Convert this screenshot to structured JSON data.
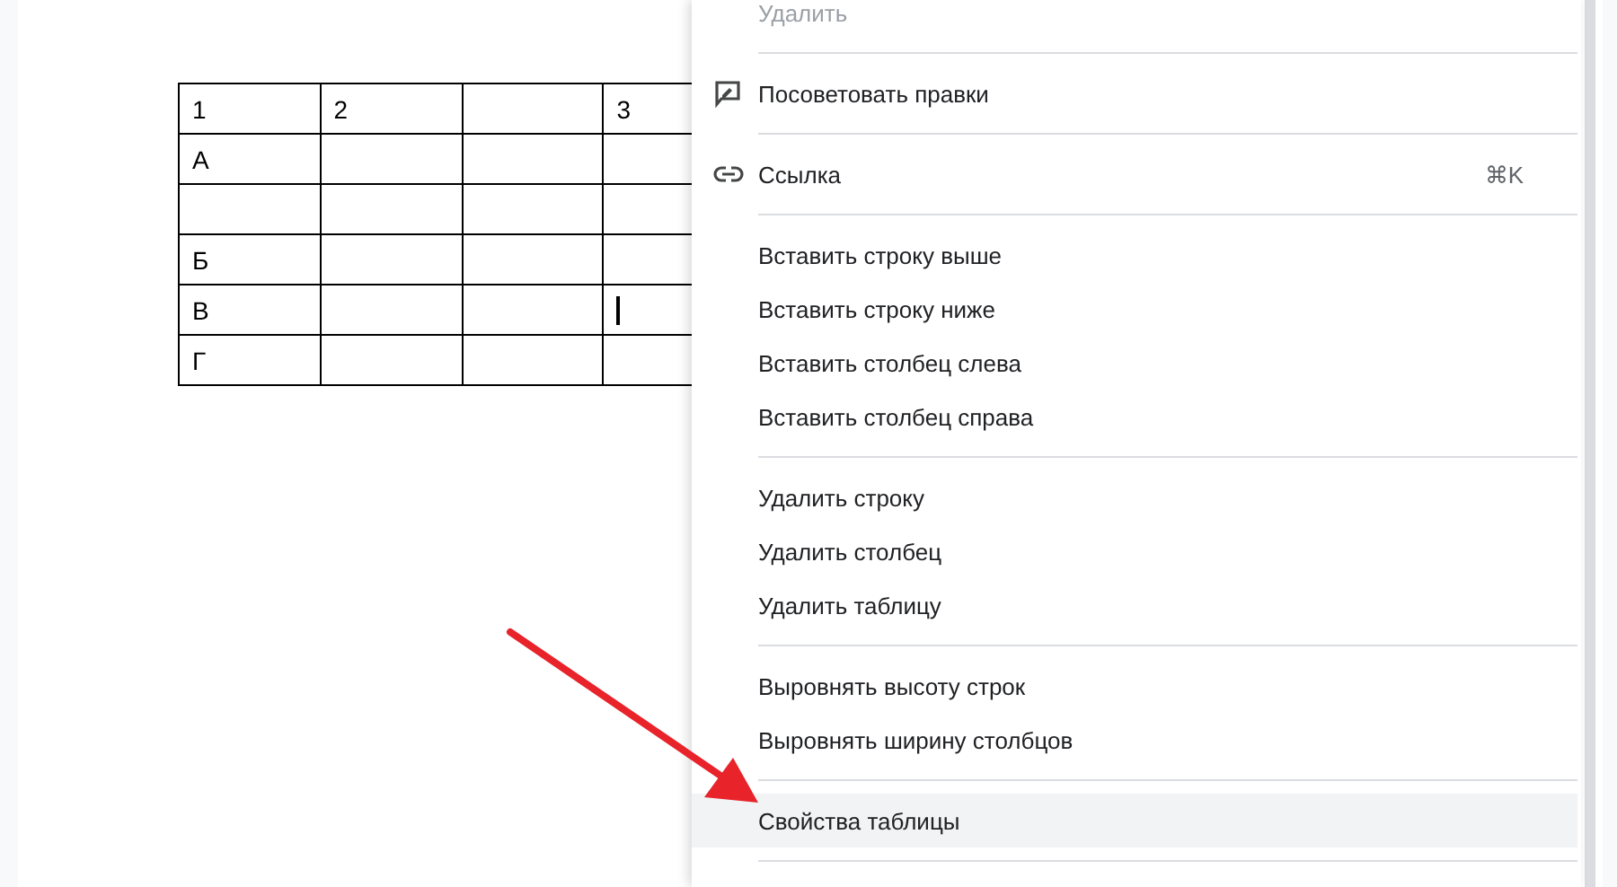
{
  "table": {
    "rows": [
      {
        "cells": [
          {
            "text": "1"
          },
          {
            "text": "2"
          },
          {},
          {
            "text": "3"
          }
        ]
      },
      {
        "cells": [
          {
            "text": "А"
          },
          {},
          {},
          {}
        ]
      },
      {
        "cells": [
          {},
          {},
          {},
          {}
        ]
      },
      {
        "cells": [
          {
            "text": "Б"
          },
          {},
          {},
          {}
        ]
      },
      {
        "cells": [
          {
            "text": "В"
          },
          {},
          {},
          {
            "cursor": true
          }
        ]
      },
      {
        "cells": [
          {
            "text": "Г"
          },
          {},
          {},
          {}
        ]
      }
    ]
  },
  "context_menu": {
    "items": [
      {
        "kind": "item",
        "label": "Удалить",
        "disabled": true,
        "selected": false
      },
      {
        "kind": "divider"
      },
      {
        "kind": "suggest",
        "label": "Посоветовать правки",
        "disabled": false,
        "selected": false
      },
      {
        "kind": "divider"
      },
      {
        "kind": "link",
        "label": "Ссылка",
        "shortcut": "⌘K",
        "disabled": false,
        "selected": false
      },
      {
        "kind": "divider"
      },
      {
        "kind": "item",
        "label": "Вставить строку выше",
        "disabled": false,
        "selected": false
      },
      {
        "kind": "item",
        "label": "Вставить строку ниже",
        "disabled": false,
        "selected": false
      },
      {
        "kind": "item",
        "label": "Вставить столбец слева",
        "disabled": false,
        "selected": false
      },
      {
        "kind": "item",
        "label": "Вставить столбец справа",
        "disabled": false,
        "selected": false
      },
      {
        "kind": "divider"
      },
      {
        "kind": "item",
        "label": "Удалить строку",
        "disabled": false,
        "selected": false
      },
      {
        "kind": "item",
        "label": "Удалить столбец",
        "disabled": false,
        "selected": false
      },
      {
        "kind": "item",
        "label": "Удалить таблицу",
        "disabled": false,
        "selected": false
      },
      {
        "kind": "divider"
      },
      {
        "kind": "item",
        "label": "Выровнять высоту строк",
        "disabled": false,
        "selected": false
      },
      {
        "kind": "item",
        "label": "Выровнять ширину столбцов",
        "disabled": false,
        "selected": false
      },
      {
        "kind": "divider"
      },
      {
        "kind": "item",
        "label": "Свойства таблицы",
        "disabled": false,
        "selected": true
      },
      {
        "kind": "divider"
      }
    ]
  }
}
